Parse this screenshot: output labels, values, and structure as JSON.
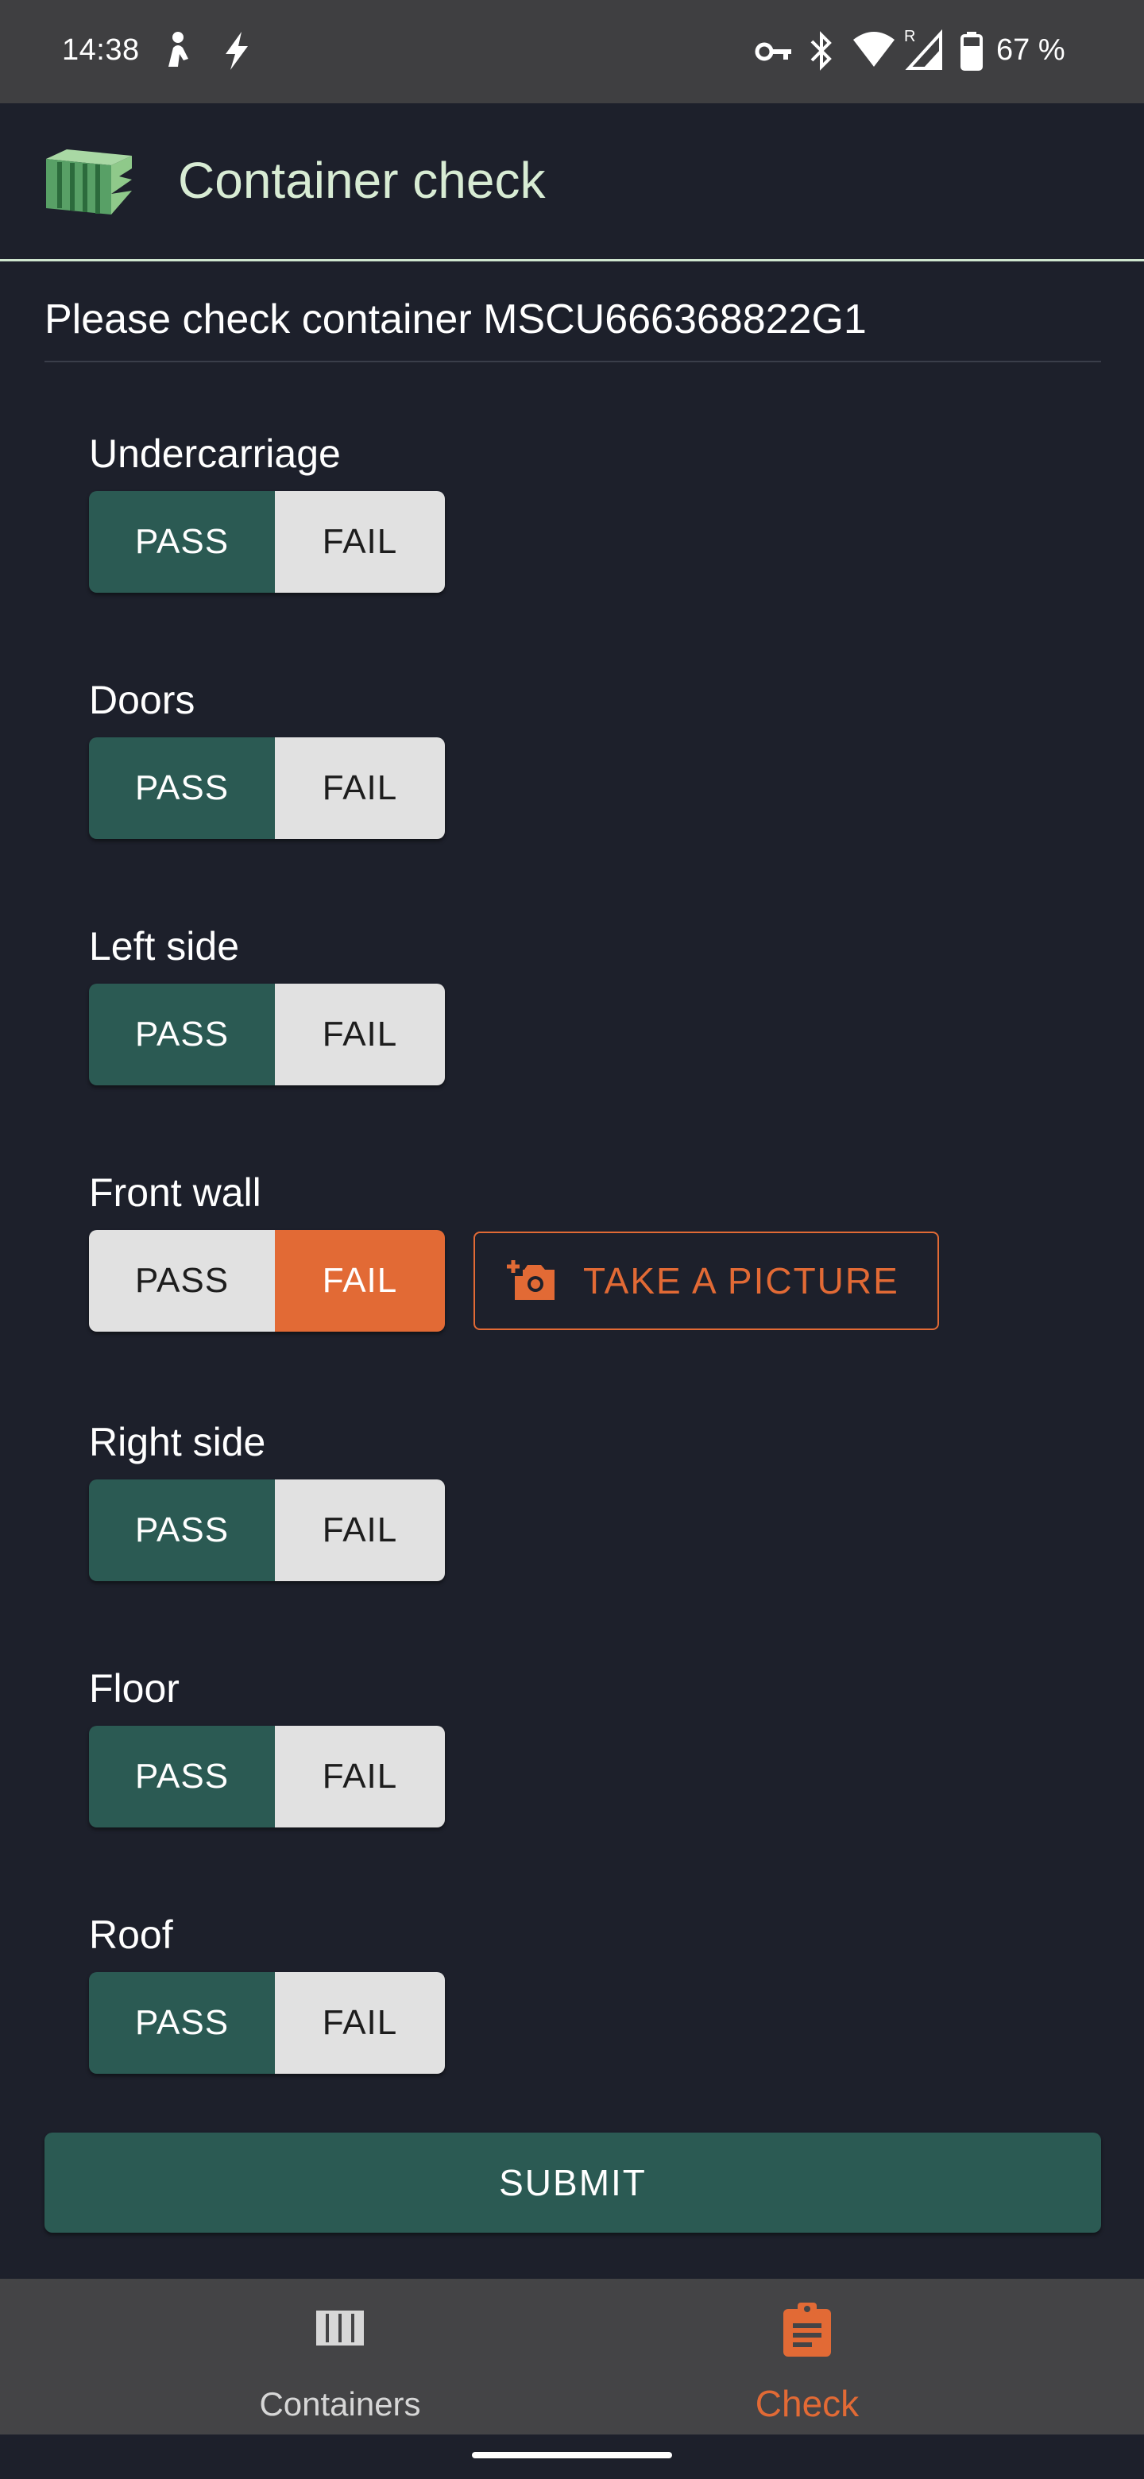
{
  "status_bar": {
    "time": "14:38",
    "battery": "67 %",
    "icons": [
      "person-icon",
      "bolt-icon",
      "vpn-key-icon",
      "bluetooth-icon",
      "wifi-icon",
      "cellular-roaming-icon",
      "battery-icon"
    ]
  },
  "app_bar": {
    "title": "Container check",
    "logo": "container-logo"
  },
  "main": {
    "instruction": "Please check container MSCU666368822G1",
    "checks": [
      {
        "label": "Undercarriage",
        "pass_label": "PASS",
        "fail_label": "FAIL",
        "selected": "pass"
      },
      {
        "label": "Doors",
        "pass_label": "PASS",
        "fail_label": "FAIL",
        "selected": "pass"
      },
      {
        "label": "Left side",
        "pass_label": "PASS",
        "fail_label": "FAIL",
        "selected": "pass"
      },
      {
        "label": "Front wall",
        "pass_label": "PASS",
        "fail_label": "FAIL",
        "selected": "fail",
        "picture_label": "TAKE A PICTURE"
      },
      {
        "label": "Right side",
        "pass_label": "PASS",
        "fail_label": "FAIL",
        "selected": "pass"
      },
      {
        "label": "Floor",
        "pass_label": "PASS",
        "fail_label": "FAIL",
        "selected": "pass"
      },
      {
        "label": "Roof",
        "pass_label": "PASS",
        "fail_label": "FAIL",
        "selected": "pass"
      }
    ],
    "submit_label": "SUBMIT"
  },
  "bottom_nav": {
    "items": [
      {
        "label": "Containers",
        "icon": "containers-icon",
        "active": false
      },
      {
        "label": "Check",
        "icon": "clipboard-icon",
        "active": true
      }
    ]
  },
  "colors": {
    "background": "#1d202b",
    "pass_active": "#2b5a53",
    "fail_active": "#e26a35",
    "accent": "#e26a35",
    "title": "#d8ecd4"
  }
}
